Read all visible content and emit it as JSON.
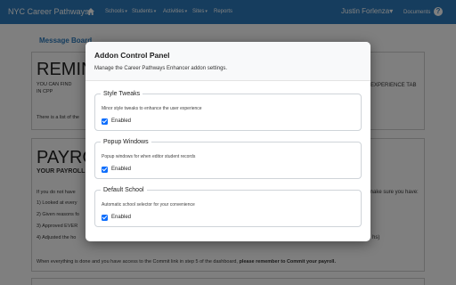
{
  "navbar": {
    "brand": "NYC Career Pathways",
    "items": [
      {
        "label": "Schools"
      },
      {
        "label": "Students"
      },
      {
        "label": "Activities"
      },
      {
        "label": "Sites"
      },
      {
        "label": "Reports"
      }
    ],
    "user": "Justin Forlenza",
    "documents": "Documents",
    "caret": "▾",
    "help": "?"
  },
  "background": {
    "board_title": "Message Board",
    "panel1": {
      "heading": "REMINDE",
      "line1": "YOU CAN FIND",
      "line2": "IN CPP",
      "line3": "There is a list of the",
      "right1": "EXPERIENCE TAB"
    },
    "panel2": {
      "heading": "PAYROL",
      "sub": "YOUR PAYROLL",
      "line1": "If you do not have",
      "right1": "make sure you have:",
      "list1": "1)  Looked at every",
      "list2": "2)  Given reasons fo",
      "list3": "3)  Approved EVER",
      "list4": "4)  Adjusted the ho",
      "right4": "hs)",
      "footer_plain": "When everything is done and you have access to the Commit link in step 5 of the dashboard, ",
      "footer_bold": "please remember to Commit your payroll."
    }
  },
  "modal": {
    "title": "Addon Control Panel",
    "subtitle": "Manage the Career Pathways Enhancer addon settings.",
    "sections": [
      {
        "title": "Style Tweaks",
        "description": "Minor style tweaks to enhance the user experience",
        "checkbox_label": "Enabled",
        "checked": true
      },
      {
        "title": "Popup Windows",
        "description": "Popup windows for when editor student records",
        "checkbox_label": "Enabled",
        "checked": true
      },
      {
        "title": "Default School",
        "description": "Automatic school selector for your convenience",
        "checkbox_label": "Enabled",
        "checked": true
      }
    ]
  }
}
